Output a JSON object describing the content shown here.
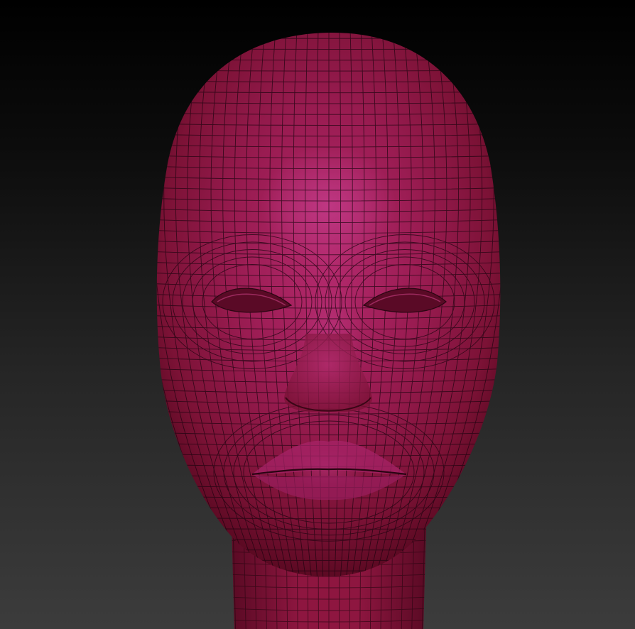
{
  "viewport": {
    "model": "head-mesh",
    "material": {
      "base": "#8e1640",
      "light": "#b42a6e",
      "highlight": "#c13985",
      "shadow": "#4a0620",
      "wire": "#1e0410"
    },
    "background": {
      "top": "#000000",
      "bottom": "#3c3c3c"
    }
  }
}
